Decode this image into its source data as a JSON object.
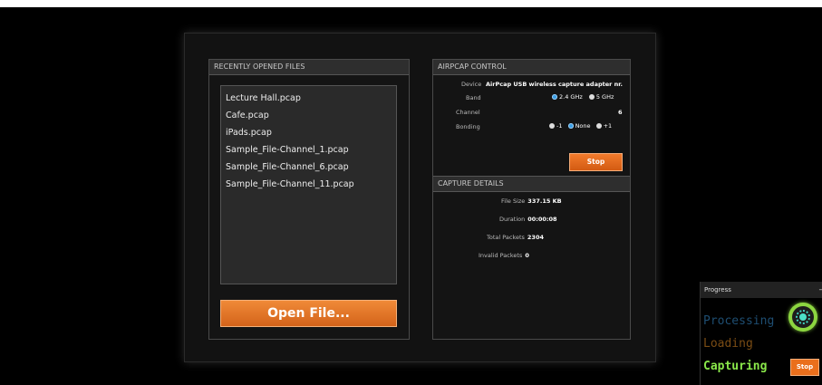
{
  "recent": {
    "title": "RECENTLY OPENED FILES",
    "files": [
      "Lecture Hall.pcap",
      "Cafe.pcap",
      "iPads.pcap",
      "Sample_File-Channel_1.pcap",
      "Sample_File-Channel_6.pcap",
      "Sample_File-Channel_11.pcap"
    ],
    "open_button": "Open File..."
  },
  "airpcap": {
    "title": "AIRPCAP CONTROL",
    "device_label": "Device",
    "device_value": "AirPcap USB wireless capture adapter nr. (",
    "band_label": "Band",
    "band_options": [
      "2.4 GHz",
      "5 GHz"
    ],
    "band_selected": "2.4 GHz",
    "channel_label": "Channel",
    "channel_value": "6",
    "bonding_label": "Bonding",
    "bonding_options": [
      "-1",
      "None",
      "+1"
    ],
    "bonding_selected": "None",
    "stop_button": "Stop"
  },
  "capture": {
    "title": "CAPTURE DETAILS",
    "file_size_label": "File Size",
    "file_size_value": "337.15 KB",
    "duration_label": "Duration",
    "duration_value": "00:00:08",
    "total_packets_label": "Total Packets",
    "total_packets_value": "2304",
    "invalid_packets_label": "Invalid Packets",
    "invalid_packets_value": "0"
  },
  "progress": {
    "title": "Progress",
    "minimize": "–",
    "states": [
      "Processing",
      "Loading",
      "Capturing"
    ],
    "active_state": "Capturing",
    "stop_button": "Stop",
    "colors": {
      "processing": "#1e4e72",
      "loading": "#7a4c14",
      "capturing": "#8ae84a"
    }
  },
  "colors": {
    "accent": "#e0701f",
    "radio_selected": "#3a9ee6"
  }
}
